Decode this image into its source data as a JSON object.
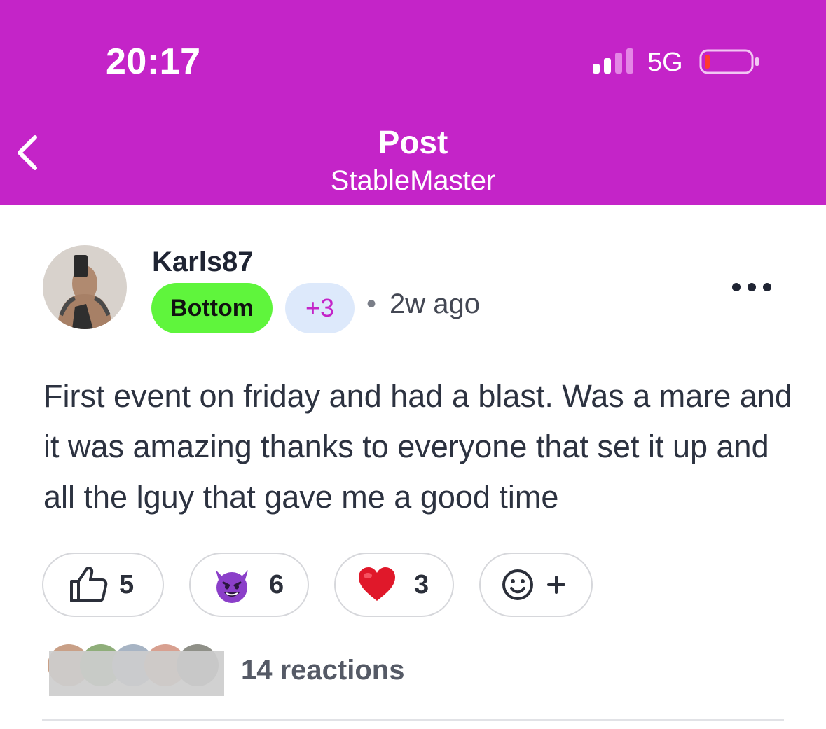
{
  "status_bar": {
    "time": "20:17",
    "network": "5G",
    "signal_bars_active": 2,
    "battery_level": 0.08
  },
  "header": {
    "title": "Post",
    "subtitle": "StableMaster",
    "back_icon": "chevron-left-icon",
    "background_color": "#c424c8"
  },
  "post": {
    "author": "Karls87",
    "role_badge": "Bottom",
    "role_badge_color": "#5ff53c",
    "more_badges": "+3",
    "separator": "•",
    "time_ago": "2w ago",
    "body": "First event on friday and had a blast. Was a mare and it was amazing thanks to everyone that set it up and all the lguy that gave me a good time",
    "menu_icon": "more-horizontal-icon"
  },
  "reactions": {
    "items": [
      {
        "icon": "thumbs-up-icon",
        "count": "5"
      },
      {
        "icon": "smiling-devil-emoji",
        "count": "6"
      },
      {
        "icon": "red-heart-emoji",
        "count": "3"
      }
    ],
    "add_icon": "add-reaction-icon",
    "add_label": "+",
    "summary": "14 reactions"
  }
}
